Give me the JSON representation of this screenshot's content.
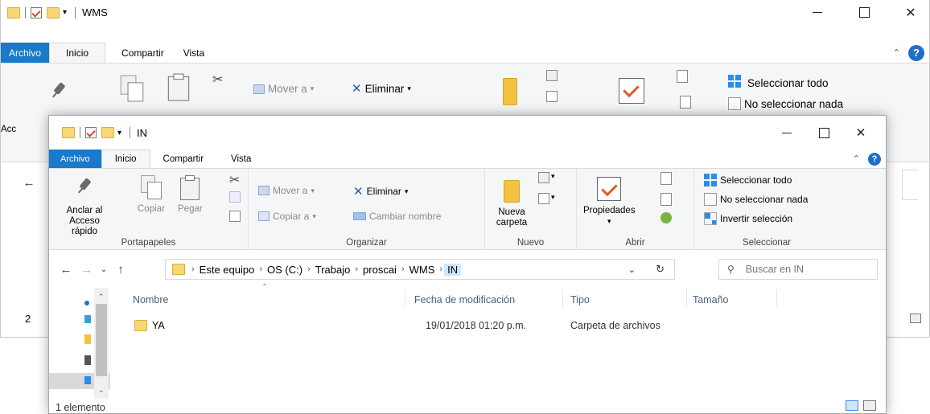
{
  "back_window": {
    "title": "WMS",
    "tabs": {
      "file": "Archivo",
      "home": "Inicio",
      "share": "Compartir",
      "view": "Vista"
    },
    "ribbon": {
      "move_to": "Mover a",
      "delete": "Eliminar",
      "select_all": "Seleccionar todo",
      "select_none": "No seleccionar nada",
      "pin_label_partial": "Acc"
    },
    "status_count_partial": "2"
  },
  "front_window": {
    "title": "IN",
    "tabs": {
      "file": "Archivo",
      "home": "Inicio",
      "share": "Compartir",
      "view": "Vista"
    },
    "ribbon": {
      "clipboard": {
        "label": "Portapapeles",
        "pin_line1": "Anclar al",
        "pin_line2": "Acceso rápido",
        "copy": "Copiar",
        "paste": "Pegar"
      },
      "organize": {
        "label": "Organizar",
        "move_to": "Mover a",
        "copy_to": "Copiar a",
        "delete": "Eliminar",
        "rename": "Cambiar nombre"
      },
      "new": {
        "label": "Nuevo",
        "new_folder_line1": "Nueva",
        "new_folder_line2": "carpeta"
      },
      "open": {
        "label": "Abrir",
        "properties": "Propiedades"
      },
      "select": {
        "label": "Seleccionar",
        "select_all": "Seleccionar todo",
        "select_none": "No seleccionar nada",
        "invert": "Invertir selección"
      }
    },
    "address": {
      "crumbs": [
        "Este equipo",
        "OS (C:)",
        "Trabajo",
        "proscai",
        "WMS",
        "IN"
      ],
      "search_placeholder": "Buscar en IN"
    },
    "columns": {
      "name": "Nombre",
      "modified": "Fecha de modificación",
      "type": "Tipo",
      "size": "Tamaño"
    },
    "rows": [
      {
        "name": "YA",
        "modified": "19/01/2018 01:20 p.m.",
        "type": "Carpeta de archivos",
        "size": ""
      }
    ],
    "status": "1 elemento"
  },
  "colors": {
    "file_tab": "#1979ca",
    "folder": "#f8d775",
    "ribbon_bg": "#f5f6f7"
  }
}
